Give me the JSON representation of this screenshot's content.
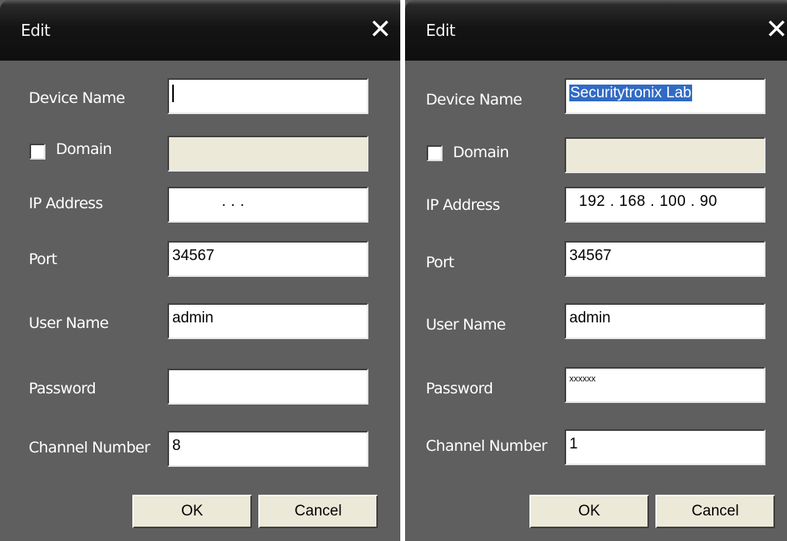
{
  "dialogs": [
    {
      "title": "Edit",
      "close_glyph": "✕",
      "labels": {
        "device_name": "Device Name",
        "domain": "Domain",
        "ip_address": "IP Address",
        "port": "Port",
        "user_name": "User Name",
        "password": "Password",
        "channel_number": "Channel Number"
      },
      "values": {
        "device_name": "",
        "domain": "",
        "domain_checked": false,
        "ip_address": ".       .       .",
        "port": "34567",
        "user_name": "admin",
        "password": "",
        "channel_number": "8"
      },
      "buttons": {
        "ok": "OK",
        "cancel": "Cancel"
      }
    },
    {
      "title": "Edit",
      "close_glyph": "✕",
      "labels": {
        "device_name": "Device Name",
        "domain": "Domain",
        "ip_address": "IP Address",
        "port": "Port",
        "user_name": "User Name",
        "password": "Password",
        "channel_number": "Channel Number"
      },
      "values": {
        "device_name": "Securitytronix Lab",
        "domain": "",
        "domain_checked": false,
        "ip_address": "192 . 168 . 100 .  90",
        "port": "34567",
        "user_name": "admin",
        "password": "xxxxxx",
        "channel_number": "1"
      },
      "buttons": {
        "ok": "OK",
        "cancel": "Cancel"
      }
    }
  ],
  "colors": {
    "dialog_bg": "#5f5f5f",
    "titlebar": "#141414",
    "selection": "#316ac5"
  }
}
